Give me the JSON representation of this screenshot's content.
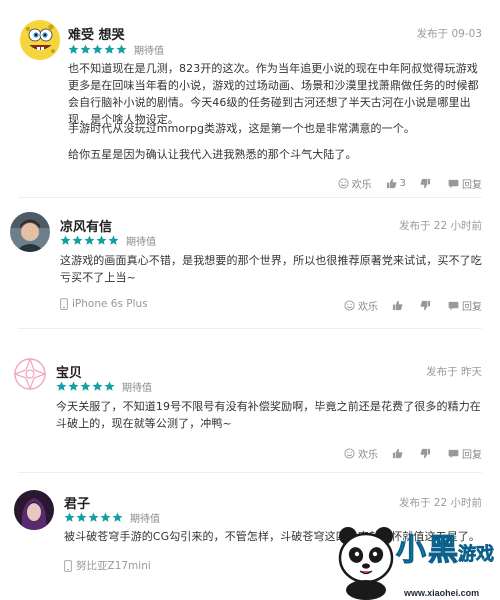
{
  "reviews": [
    {
      "name": "难受 想哭",
      "posted": "发布于 09-03",
      "rating_label": "期待值",
      "stars": 5,
      "paragraphs": [
        "也不知道现在是几测，823开的这次。作为当年追更小说的现在中年阿叔觉得玩游戏更多是在回味当年看的小说，游戏的过场动画、场景和沙漠里找萧鼎做任务的时候都会自行脑补小说的剧情。今天46级的任务碰到古河还想了半天古河在小说是哪里出现，是个啥人物设定。",
        "手游时代从没玩过mmorpg类游戏，这是第一个也是非常满意的一个。",
        "给你五星是因为确认让我代入进我熟悉的那个斗气大陆了。"
      ],
      "device": "",
      "actions": {
        "fun": "欢乐",
        "up": "3",
        "down": "",
        "reply": "回复"
      }
    },
    {
      "name": "凉风有信",
      "posted": "发布于 22 小时前",
      "rating_label": "期待值",
      "stars": 5,
      "paragraphs": [
        "这游戏的画面真心不错，是我想要的那个世界，所以也很推荐原著党来试试，买不了吃亏买不了上当~"
      ],
      "device": "iPhone 6s Plus",
      "actions": {
        "fun": "欢乐",
        "up": "",
        "down": "",
        "reply": "回复"
      }
    },
    {
      "name": "宝贝",
      "posted": "发布于 昨天",
      "rating_label": "期待值",
      "stars": 5,
      "paragraphs": [
        "今天关服了，不知道19号不限号有没有补偿奖励啊，毕竟之前还是花费了很多的精力在斗破上的，现在就等公测了，冲鸭~"
      ],
      "device": "",
      "actions": {
        "fun": "欢乐",
        "up": "",
        "down": "",
        "reply": "回复"
      }
    },
    {
      "name": "君子",
      "posted": "发布于 22 小时前",
      "rating_label": "期待值",
      "stars": 5,
      "paragraphs": [
        "被斗破苍穹手游的CG勾引来的，不管怎样，斗破苍穹这四个字就情怀就值这五星了。"
      ],
      "device": "努比亚Z17mini",
      "actions": {
        "fun": "",
        "up": "",
        "down": "",
        "reply": ""
      }
    }
  ],
  "watermark": {
    "text": "小黑游戏",
    "url": "www.xiaohei.com"
  },
  "colors": {
    "star": "#16a0a6",
    "text": "#333333",
    "muted": "#999999"
  }
}
